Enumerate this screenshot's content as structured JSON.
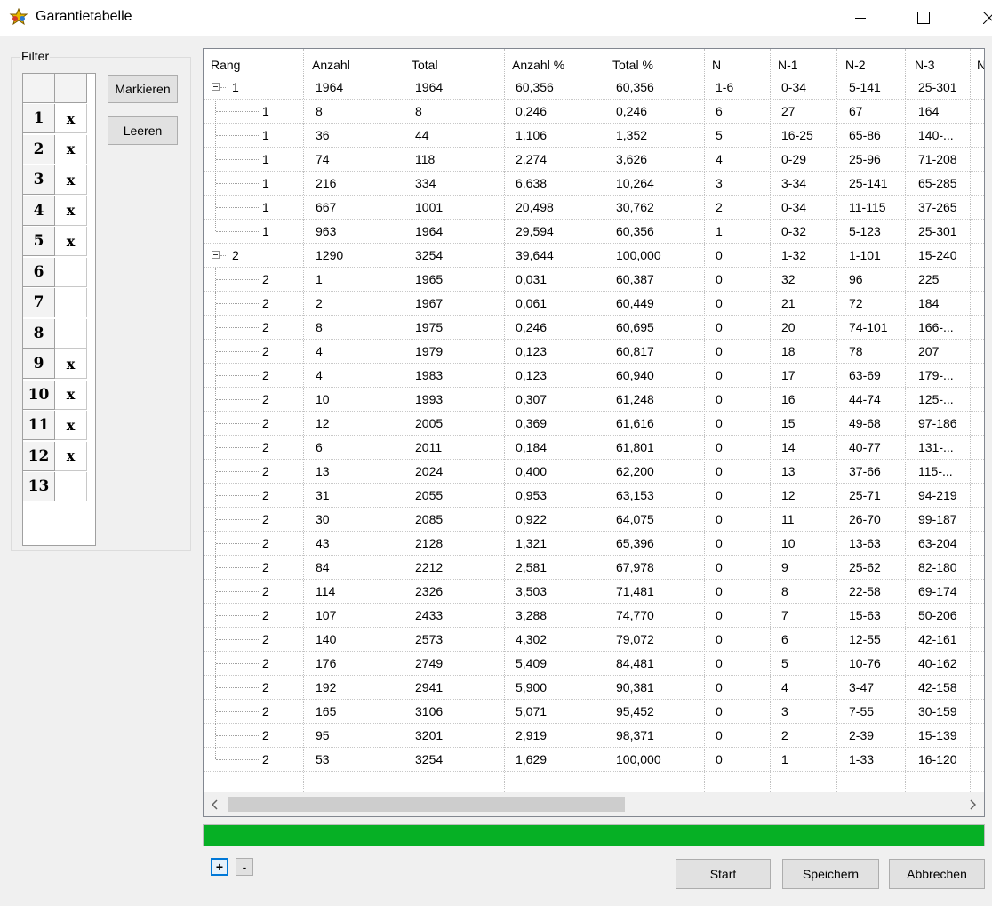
{
  "window": {
    "title": "Garantietabelle",
    "app_icon": "lottery-star-icon"
  },
  "filter": {
    "legend": "Filter",
    "rows": [
      {
        "num": "1",
        "mark": "x"
      },
      {
        "num": "2",
        "mark": "x"
      },
      {
        "num": "3",
        "mark": "x"
      },
      {
        "num": "4",
        "mark": "x"
      },
      {
        "num": "5",
        "mark": "x"
      },
      {
        "num": "6",
        "mark": ""
      },
      {
        "num": "7",
        "mark": ""
      },
      {
        "num": "8",
        "mark": ""
      },
      {
        "num": "9",
        "mark": "x"
      },
      {
        "num": "10",
        "mark": "x"
      },
      {
        "num": "11",
        "mark": "x"
      },
      {
        "num": "12",
        "mark": "x"
      },
      {
        "num": "13",
        "mark": ""
      }
    ],
    "mark_button": "Markieren",
    "clear_button": "Leeren"
  },
  "table": {
    "columns": [
      "Rang",
      "Anzahl",
      "Total",
      "Anzahl %",
      "Total %",
      "N",
      "N-1",
      "N-2",
      "N-3",
      "N"
    ],
    "rows": [
      {
        "level": 0,
        "cells": [
          "1",
          "1964",
          "1964",
          "60,356",
          "60,356",
          "1-6",
          "0-34",
          "5-141",
          "25-301"
        ]
      },
      {
        "level": 1,
        "cells": [
          "1",
          "8",
          "8",
          "0,246",
          "0,246",
          "6",
          "27",
          "67",
          "164"
        ]
      },
      {
        "level": 1,
        "cells": [
          "1",
          "36",
          "44",
          "1,106",
          "1,352",
          "5",
          "16-25",
          "65-86",
          "140-..."
        ]
      },
      {
        "level": 1,
        "cells": [
          "1",
          "74",
          "118",
          "2,274",
          "3,626",
          "4",
          "0-29",
          "25-96",
          "71-208"
        ]
      },
      {
        "level": 1,
        "cells": [
          "1",
          "216",
          "334",
          "6,638",
          "10,264",
          "3",
          "3-34",
          "25-141",
          "65-285"
        ]
      },
      {
        "level": 1,
        "cells": [
          "1",
          "667",
          "1001",
          "20,498",
          "30,762",
          "2",
          "0-34",
          "11-115",
          "37-265"
        ]
      },
      {
        "level": 1,
        "cells": [
          "1",
          "963",
          "1964",
          "29,594",
          "60,356",
          "1",
          "0-32",
          "5-123",
          "25-301"
        ]
      },
      {
        "level": 0,
        "cells": [
          "2",
          "1290",
          "3254",
          "39,644",
          "100,000",
          "0",
          "1-32",
          "1-101",
          "15-240"
        ]
      },
      {
        "level": 1,
        "cells": [
          "2",
          "1",
          "1965",
          "0,031",
          "60,387",
          "0",
          "32",
          "96",
          "225"
        ]
      },
      {
        "level": 1,
        "cells": [
          "2",
          "2",
          "1967",
          "0,061",
          "60,449",
          "0",
          "21",
          "72",
          "184"
        ]
      },
      {
        "level": 1,
        "cells": [
          "2",
          "8",
          "1975",
          "0,246",
          "60,695",
          "0",
          "20",
          "74-101",
          "166-..."
        ]
      },
      {
        "level": 1,
        "cells": [
          "2",
          "4",
          "1979",
          "0,123",
          "60,817",
          "0",
          "18",
          "78",
          "207"
        ]
      },
      {
        "level": 1,
        "cells": [
          "2",
          "4",
          "1983",
          "0,123",
          "60,940",
          "0",
          "17",
          "63-69",
          "179-..."
        ]
      },
      {
        "level": 1,
        "cells": [
          "2",
          "10",
          "1993",
          "0,307",
          "61,248",
          "0",
          "16",
          "44-74",
          "125-..."
        ]
      },
      {
        "level": 1,
        "cells": [
          "2",
          "12",
          "2005",
          "0,369",
          "61,616",
          "0",
          "15",
          "49-68",
          "97-186"
        ]
      },
      {
        "level": 1,
        "cells": [
          "2",
          "6",
          "2011",
          "0,184",
          "61,801",
          "0",
          "14",
          "40-77",
          "131-..."
        ]
      },
      {
        "level": 1,
        "cells": [
          "2",
          "13",
          "2024",
          "0,400",
          "62,200",
          "0",
          "13",
          "37-66",
          "115-..."
        ]
      },
      {
        "level": 1,
        "cells": [
          "2",
          "31",
          "2055",
          "0,953",
          "63,153",
          "0",
          "12",
          "25-71",
          "94-219"
        ]
      },
      {
        "level": 1,
        "cells": [
          "2",
          "30",
          "2085",
          "0,922",
          "64,075",
          "0",
          "11",
          "26-70",
          "99-187"
        ]
      },
      {
        "level": 1,
        "cells": [
          "2",
          "43",
          "2128",
          "1,321",
          "65,396",
          "0",
          "10",
          "13-63",
          "63-204"
        ]
      },
      {
        "level": 1,
        "cells": [
          "2",
          "84",
          "2212",
          "2,581",
          "67,978",
          "0",
          "9",
          "25-62",
          "82-180"
        ]
      },
      {
        "level": 1,
        "cells": [
          "2",
          "114",
          "2326",
          "3,503",
          "71,481",
          "0",
          "8",
          "22-58",
          "69-174"
        ]
      },
      {
        "level": 1,
        "cells": [
          "2",
          "107",
          "2433",
          "3,288",
          "74,770",
          "0",
          "7",
          "15-63",
          "50-206"
        ]
      },
      {
        "level": 1,
        "cells": [
          "2",
          "140",
          "2573",
          "4,302",
          "79,072",
          "0",
          "6",
          "12-55",
          "42-161"
        ]
      },
      {
        "level": 1,
        "cells": [
          "2",
          "176",
          "2749",
          "5,409",
          "84,481",
          "0",
          "5",
          "10-76",
          "40-162"
        ]
      },
      {
        "level": 1,
        "cells": [
          "2",
          "192",
          "2941",
          "5,900",
          "90,381",
          "0",
          "4",
          "3-47",
          "42-158"
        ]
      },
      {
        "level": 1,
        "cells": [
          "2",
          "165",
          "3106",
          "5,071",
          "95,452",
          "0",
          "3",
          "7-55",
          "30-159"
        ]
      },
      {
        "level": 1,
        "cells": [
          "2",
          "95",
          "3201",
          "2,919",
          "98,371",
          "0",
          "2",
          "2-39",
          "15-139"
        ]
      },
      {
        "level": 1,
        "cells": [
          "2",
          "53",
          "3254",
          "1,629",
          "100,000",
          "0",
          "1",
          "1-33",
          "16-120"
        ]
      }
    ]
  },
  "progress": {
    "fraction": 1.0,
    "color": "#06b025"
  },
  "footer": {
    "plus_label": "+",
    "minus_label": "-",
    "start_button": "Start",
    "save_button": "Speichern",
    "cancel_button": "Abbrechen"
  }
}
